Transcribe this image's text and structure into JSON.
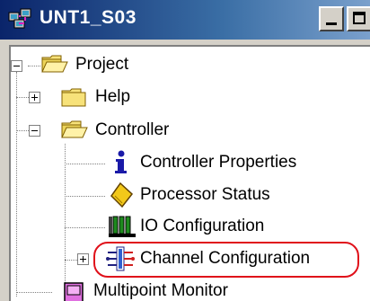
{
  "window": {
    "title": "UNT1_S03"
  },
  "tree": {
    "project": "Project",
    "help": "Help",
    "controller": "Controller",
    "controller_properties": "Controller Properties",
    "processor_status": "Processor Status",
    "io_configuration": "IO Configuration",
    "channel_configuration": "Channel Configuration",
    "multipoint_monitor": "Multipoint Monitor"
  },
  "colors": {
    "titlebar": "#0a246a",
    "folder": "#f7e27a",
    "highlight_ring": "#e0101a"
  }
}
